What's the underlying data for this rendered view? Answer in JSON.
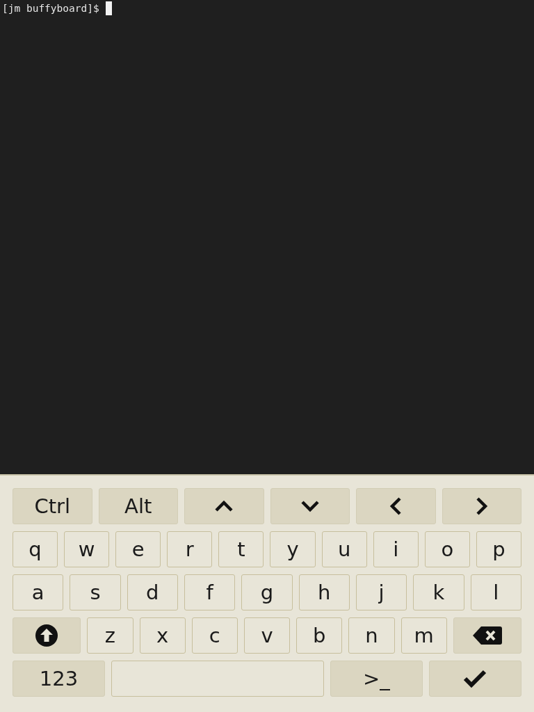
{
  "terminal": {
    "prompt": "[jm buffyboard]$"
  },
  "keyboard": {
    "rows": [
      {
        "keys": [
          {
            "kind": "mod",
            "label": "Ctrl"
          },
          {
            "kind": "mod",
            "label": "Alt"
          },
          {
            "kind": "up"
          },
          {
            "kind": "down"
          },
          {
            "kind": "left"
          },
          {
            "kind": "right"
          }
        ]
      },
      {
        "keys": [
          {
            "kind": "letter",
            "label": "q"
          },
          {
            "kind": "letter",
            "label": "w"
          },
          {
            "kind": "letter",
            "label": "e"
          },
          {
            "kind": "letter",
            "label": "r"
          },
          {
            "kind": "letter",
            "label": "t"
          },
          {
            "kind": "letter",
            "label": "y"
          },
          {
            "kind": "letter",
            "label": "u"
          },
          {
            "kind": "letter",
            "label": "i"
          },
          {
            "kind": "letter",
            "label": "o"
          },
          {
            "kind": "letter",
            "label": "p"
          }
        ]
      },
      {
        "keys": [
          {
            "kind": "letter",
            "label": "a"
          },
          {
            "kind": "letter",
            "label": "s"
          },
          {
            "kind": "letter",
            "label": "d"
          },
          {
            "kind": "letter",
            "label": "f"
          },
          {
            "kind": "letter",
            "label": "g"
          },
          {
            "kind": "letter",
            "label": "h"
          },
          {
            "kind": "letter",
            "label": "j"
          },
          {
            "kind": "letter",
            "label": "k"
          },
          {
            "kind": "letter",
            "label": "l"
          }
        ]
      },
      {
        "keys": [
          {
            "kind": "shift"
          },
          {
            "kind": "letter",
            "label": "z"
          },
          {
            "kind": "letter",
            "label": "x"
          },
          {
            "kind": "letter",
            "label": "c"
          },
          {
            "kind": "letter",
            "label": "v"
          },
          {
            "kind": "letter",
            "label": "b"
          },
          {
            "kind": "letter",
            "label": "n"
          },
          {
            "kind": "letter",
            "label": "m"
          },
          {
            "kind": "backspace"
          }
        ]
      },
      {
        "keys": [
          {
            "kind": "mod",
            "label": "123"
          },
          {
            "kind": "space"
          },
          {
            "kind": "mod",
            "label": ">_"
          },
          {
            "kind": "enter"
          }
        ]
      }
    ]
  }
}
